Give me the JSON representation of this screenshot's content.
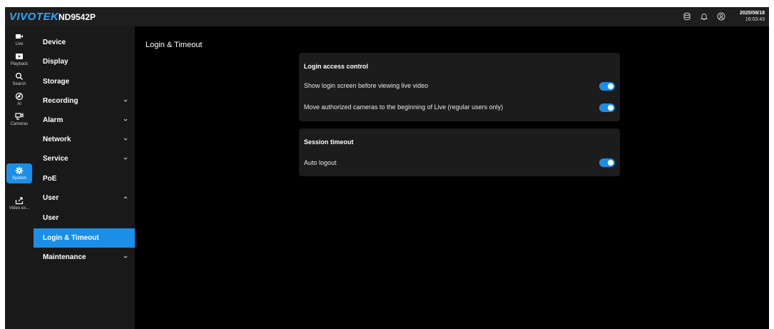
{
  "header": {
    "brand": "VIVOTEK",
    "model": "ND9542P",
    "icons": [
      "storage-icon",
      "bell-icon",
      "user-circle-icon"
    ],
    "date": "2025/08/18",
    "time": "16:03:43"
  },
  "rail": [
    {
      "label": "Live",
      "icon": "video-camera-icon"
    },
    {
      "label": "Playback",
      "icon": "playback-icon"
    },
    {
      "label": "Search",
      "icon": "search-icon"
    },
    {
      "label": "AI",
      "icon": "ai-icon"
    },
    {
      "label": "Cameras",
      "icon": "cameras-icon"
    },
    {
      "label": "System",
      "icon": "gear-icon",
      "active": true
    },
    {
      "label": "Video ex...",
      "icon": "export-icon"
    }
  ],
  "menu": [
    {
      "label": "Device"
    },
    {
      "label": "Display"
    },
    {
      "label": "Storage"
    },
    {
      "label": "Recording",
      "chevron": "down"
    },
    {
      "label": "Alarm",
      "chevron": "down"
    },
    {
      "label": "Network",
      "chevron": "down"
    },
    {
      "label": "Service",
      "chevron": "down"
    },
    {
      "label": "PoE"
    },
    {
      "label": "User",
      "chevron": "up"
    },
    {
      "label": "User",
      "sub": true
    },
    {
      "label": "Login & Timeout",
      "sub": true,
      "active": true
    },
    {
      "label": "Maintenance",
      "chevron": "down"
    }
  ],
  "main": {
    "title": "Login & Timeout",
    "login_card": {
      "title": "Login access control",
      "rows": [
        {
          "label": "Show login screen before viewing live video",
          "enabled": true
        },
        {
          "label": "Move authorized cameras to the beginning of Live (regular users only)",
          "enabled": true
        }
      ]
    },
    "session_card": {
      "title": "Session timeout",
      "rows": [
        {
          "label": "Auto logout",
          "enabled": true
        }
      ]
    }
  },
  "colors": {
    "accent": "#1b8ee8",
    "brand": "#29a8ff",
    "background": "#000000",
    "panel": "#1c1c1c"
  }
}
